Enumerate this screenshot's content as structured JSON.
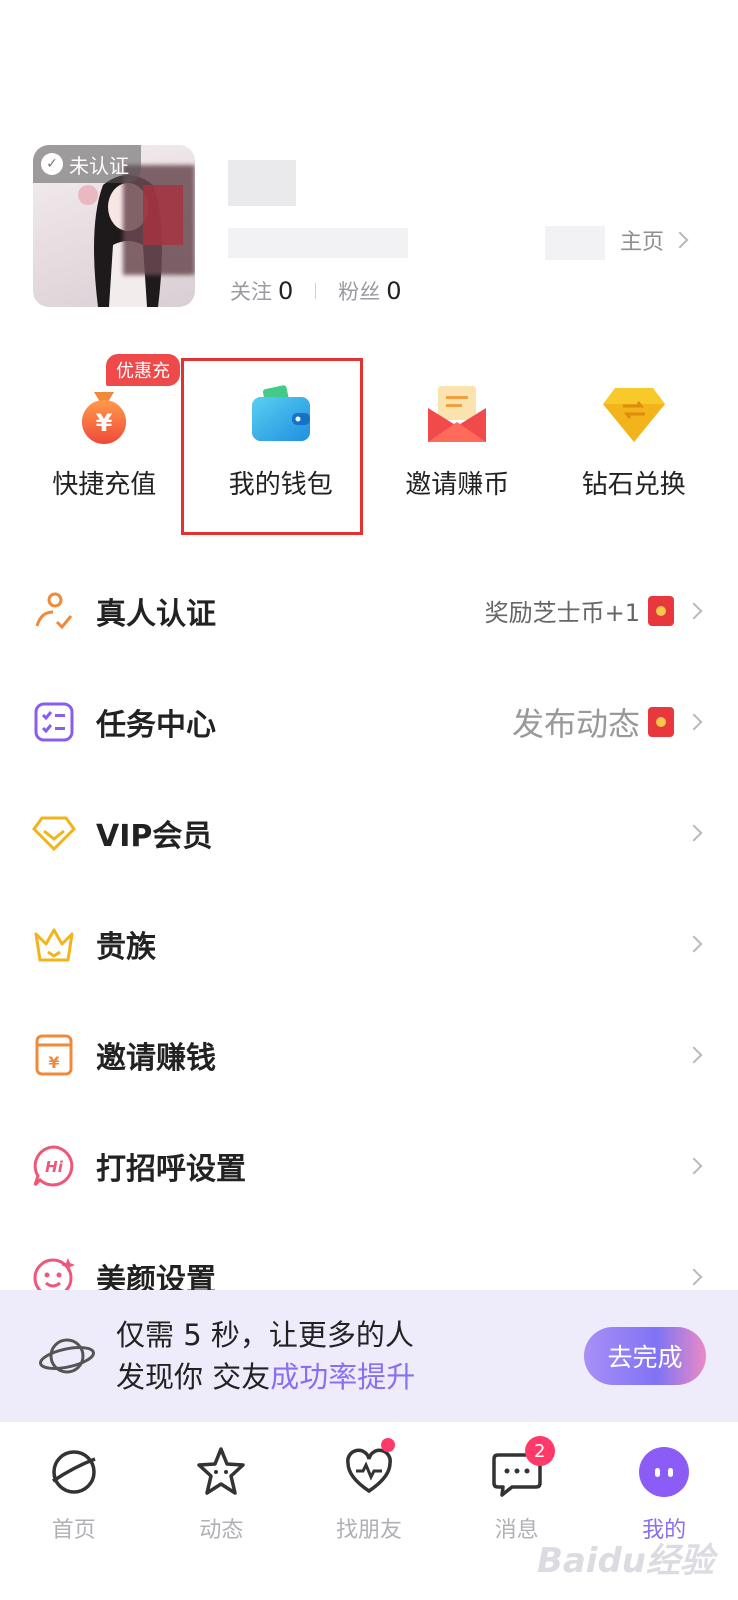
{
  "profile": {
    "badge": "未认证",
    "home_link": "主页",
    "following_label": "关注",
    "following_count": "0",
    "fans_label": "粉丝",
    "fans_count": "0"
  },
  "shortcuts": [
    {
      "label": "快捷充值",
      "tag": "优惠充",
      "icon": "money-bag-icon"
    },
    {
      "label": "我的钱包",
      "icon": "wallet-icon"
    },
    {
      "label": "邀请赚币",
      "icon": "envelope-icon"
    },
    {
      "label": "钻石兑换",
      "icon": "diamond-icon"
    }
  ],
  "menu": [
    {
      "title": "真人认证",
      "extra": "奖励芝士币+1",
      "icon": "person-verify-icon"
    },
    {
      "title": "任务中心",
      "extra": "发布动态",
      "icon": "task-list-icon"
    },
    {
      "title": "VIP会员",
      "icon": "vip-diamond-icon"
    },
    {
      "title": "贵族",
      "icon": "crown-icon"
    },
    {
      "title": "邀请赚钱",
      "icon": "invite-money-icon"
    },
    {
      "title": "打招呼设置",
      "icon": "hi-bubble-icon"
    },
    {
      "title": "美颜设置",
      "icon": "beauty-face-icon"
    }
  ],
  "banner": {
    "line1": "仅需 5 秒，让更多的人",
    "line2_plain": "发现你 交友",
    "line2_highlight": "成功率提升",
    "button": "去完成"
  },
  "tabs": [
    {
      "label": "首页",
      "icon": "planet-icon"
    },
    {
      "label": "动态",
      "icon": "star-icon"
    },
    {
      "label": "找朋友",
      "icon": "heart-pulse-icon",
      "dot": true
    },
    {
      "label": "消息",
      "icon": "chat-bubble-icon",
      "badge": "2"
    },
    {
      "label": "我的",
      "icon": "me-face-icon",
      "active": true
    }
  ],
  "watermark": "Baidu经验",
  "colors": {
    "accent": "#8a6ff0",
    "highlight_border": "#e33232",
    "badge_red": "#ff3a6a"
  }
}
